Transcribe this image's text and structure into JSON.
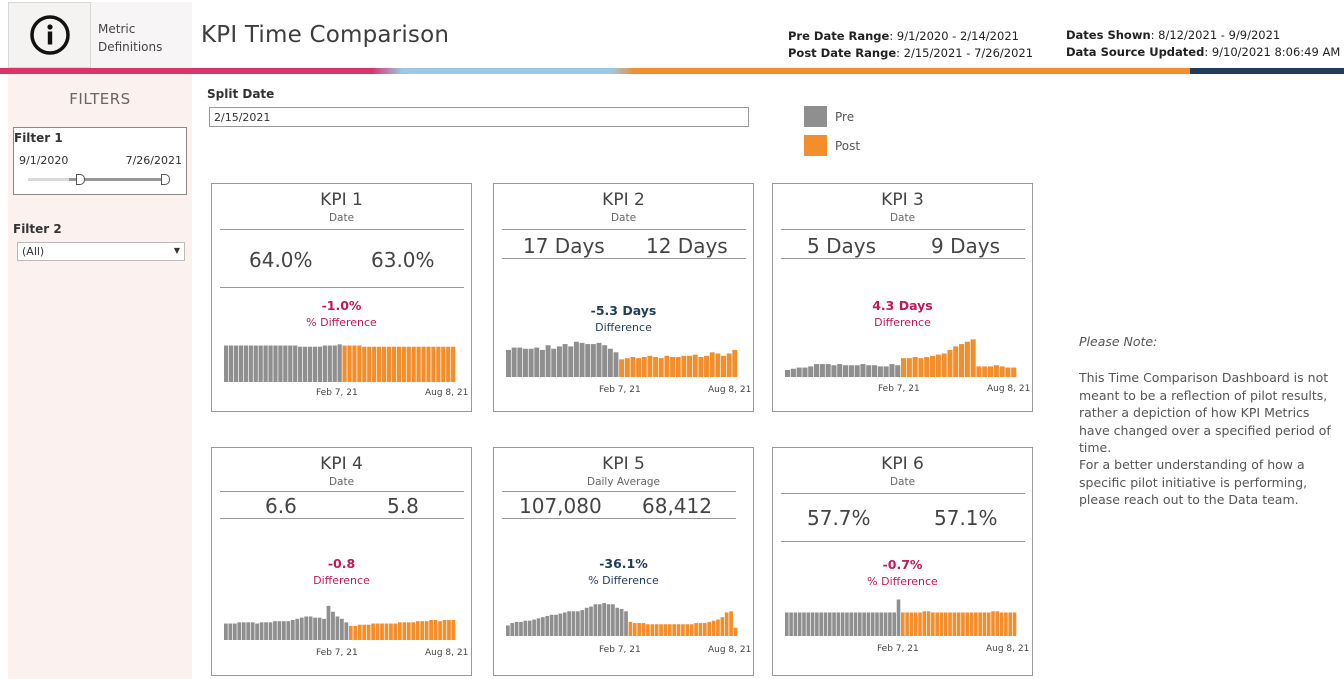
{
  "header": {
    "info_icon": "info-circle-icon",
    "metric_definitions": "Metric Definitions",
    "title": "KPI Time Comparison",
    "pre_range_label": "Pre Date Range",
    "pre_range_value": ": 9/1/2020 - 2/14/2021",
    "post_range_label": "Post Date Range",
    "post_range_value": ":  2/15/2021 -  7/26/2021",
    "dates_shown_label": "Dates Shown",
    "dates_shown_value": ": 8/12/2021 - 9/9/2021",
    "data_source_label": "Data Source Updated",
    "data_source_value": ": 9/10/2021 8:06:49 AM"
  },
  "colors": {
    "pre": "#8f8f8f",
    "post": "#f28e2b",
    "positive_diff": "#c2185b",
    "negative_diff": "#1f3c5a",
    "bar_pink": "#d9356b",
    "bar_blue": "#9cc8e6",
    "bar_orange": "#f28e2b",
    "bar_navy": "#1f3c5a"
  },
  "sidebar": {
    "title": "FILTERS",
    "filter1": {
      "label": "Filter 1",
      "min": "9/1/2020",
      "max": "7/26/2021"
    },
    "filter2": {
      "label": "Filter 2",
      "value": "(All)"
    }
  },
  "split_date": {
    "label": "Split Date",
    "value": "2/15/2021"
  },
  "legend": [
    {
      "label": "Pre",
      "color": "#8f8f8f"
    },
    {
      "label": "Post",
      "color": "#f28e2b"
    }
  ],
  "kpis": [
    {
      "title": "KPI 1",
      "subtitle": "Date",
      "pre": "64.0%",
      "post": "63.0%",
      "diff": "-1.0%",
      "diff_label": "% Difference",
      "axis_start": "Feb 7, 21",
      "axis_end": "Aug 8, 21"
    },
    {
      "title": "KPI 2",
      "subtitle": "Date",
      "pre": "17 Days",
      "post": "12 Days",
      "diff": "-5.3 Days",
      "diff_label": "Difference",
      "axis_start": "Feb 7, 21",
      "axis_end": "Aug 8, 21"
    },
    {
      "title": "KPI 3",
      "subtitle": "Date",
      "pre": "5 Days",
      "post": "9 Days",
      "diff": "4.3 Days",
      "diff_label": "Difference",
      "axis_start": "Feb 7, 21",
      "axis_end": "Aug 8, 21"
    },
    {
      "title": "KPI 4",
      "subtitle": "Date",
      "pre": "6.6",
      "post": "5.8",
      "diff": "-0.8",
      "diff_label": "Difference",
      "axis_start": "Feb 7, 21",
      "axis_end": "Aug 8, 21"
    },
    {
      "title": "KPI 5",
      "subtitle": "Daily Average",
      "pre": "107,080",
      "post": "68,412",
      "diff": "-36.1%",
      "diff_label": "% Difference",
      "axis_start": "Feb 7, 21",
      "axis_end": "Aug 8, 21"
    },
    {
      "title": "KPI 6",
      "subtitle": "Date",
      "pre": "57.7%",
      "post": "57.1%",
      "diff": "-0.7%",
      "diff_label": "% Difference",
      "axis_start": "Feb 7, 21",
      "axis_end": "Aug 8, 21"
    }
  ],
  "sparklines": [
    {
      "pre": [
        31,
        31,
        31,
        31,
        31,
        31,
        31,
        31,
        31,
        31,
        31,
        31,
        31,
        31,
        31,
        30,
        30,
        30,
        30,
        30,
        31,
        31,
        31,
        32
      ],
      "post": [
        31,
        31,
        31,
        31,
        30,
        30,
        30,
        30,
        30,
        30,
        30,
        30,
        30,
        30,
        30,
        30,
        30,
        30,
        30,
        30,
        30,
        30,
        30
      ]
    },
    {
      "pre": [
        23,
        25,
        25,
        24,
        24,
        25,
        23,
        27,
        24,
        26,
        28,
        26,
        30,
        29,
        28,
        28,
        29,
        27,
        24,
        21
      ],
      "post": [
        15,
        16,
        17,
        16,
        17,
        18,
        17,
        16,
        18,
        17,
        17,
        18,
        18,
        19,
        17,
        18,
        21,
        20,
        18,
        20,
        23
      ]
    },
    {
      "pre": [
        6,
        7,
        8,
        8,
        9,
        11,
        11,
        11,
        10,
        11,
        10,
        10,
        10,
        11,
        10,
        10,
        9,
        9,
        11,
        10
      ],
      "post": [
        16,
        16,
        17,
        16,
        17,
        18,
        19,
        20,
        23,
        26,
        28,
        30,
        32,
        9,
        9,
        9,
        10,
        9,
        8,
        8
      ]
    },
    {
      "pre": [
        14,
        14,
        14,
        15,
        15,
        15,
        15,
        14,
        15,
        15,
        15,
        16,
        16,
        16,
        16,
        17,
        18,
        19,
        20,
        20,
        19,
        19,
        18,
        29,
        24,
        20,
        18,
        15
      ],
      "post": [
        12,
        12,
        13,
        13,
        13,
        14,
        14,
        14,
        14,
        14,
        14,
        15,
        15,
        15,
        15,
        16,
        16,
        16,
        17,
        17,
        16,
        17,
        17,
        17
      ]
    },
    {
      "pre": [
        9,
        11,
        12,
        12,
        13,
        13,
        14,
        15,
        16,
        17,
        18,
        18,
        19,
        20,
        21,
        21,
        21,
        22,
        24,
        25,
        27,
        27,
        28,
        27,
        27,
        24,
        23,
        21
      ],
      "post": [
        12,
        11,
        11,
        11,
        10,
        10,
        10,
        10,
        10,
        10,
        10,
        10,
        10,
        10,
        10,
        11,
        11,
        11,
        12,
        13,
        14,
        16,
        20,
        21,
        7
      ]
    },
    {
      "pre": [
        20,
        20,
        20,
        20,
        20,
        20,
        20,
        20,
        20,
        20,
        20,
        20,
        20,
        20,
        20,
        20,
        20,
        20,
        20,
        20,
        20,
        20,
        20,
        20,
        20,
        20,
        31
      ],
      "post": [
        20,
        20,
        20,
        20,
        20,
        21,
        21,
        20,
        20,
        20,
        20,
        20,
        20,
        20,
        20,
        20,
        20,
        20,
        20,
        20,
        20,
        21,
        21,
        20,
        20,
        20,
        20
      ]
    }
  ],
  "note": {
    "title": "Please Note:",
    "p1": "This Time Comparison Dashboard is not meant to be a reflection of pilot results, rather a depiction of how KPI Metrics have changed over a specified period of time.",
    "p2": "For a better understanding of how a specific pilot initiative is performing, please reach out to the Data team."
  }
}
